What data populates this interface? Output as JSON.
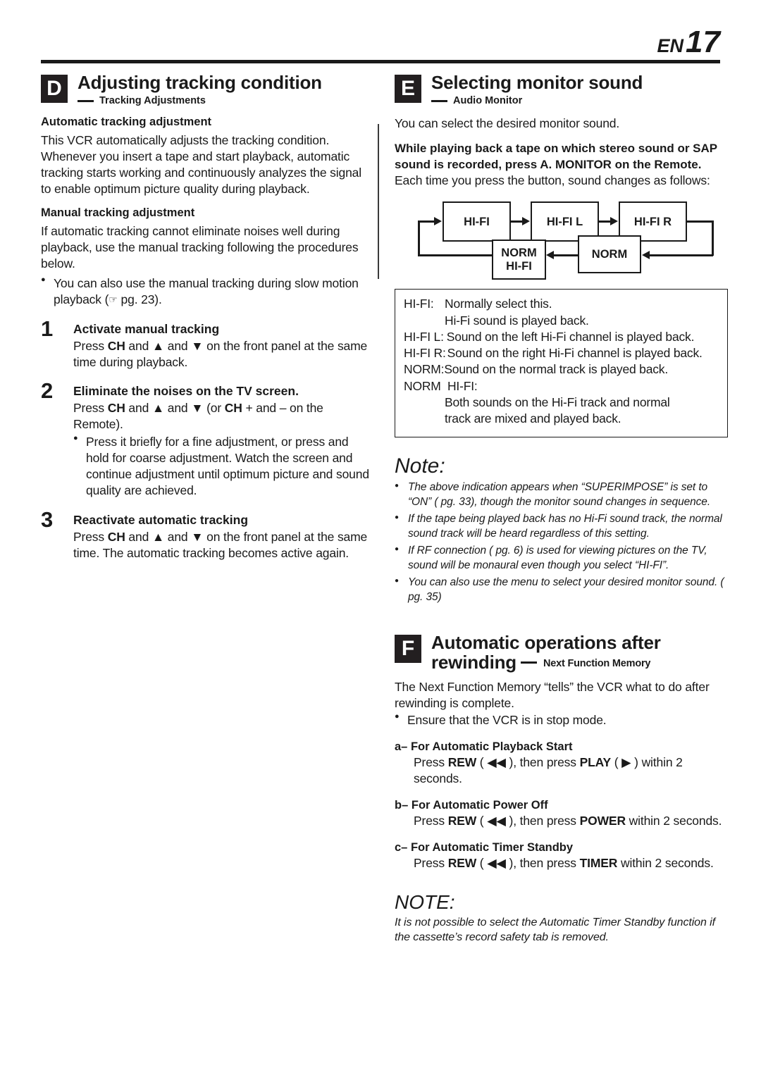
{
  "page": {
    "prefix": "EN",
    "number": "17"
  },
  "icons": {
    "hand_pointer": "☞",
    "triangle_up": "▲",
    "triangle_down": "▼",
    "rewind": "◀◀",
    "play": "▶",
    "bullet": "●"
  },
  "colors": {
    "ink": "#1a1a1a",
    "badge_bg": "#231f20",
    "badge_fg": "#ffffff",
    "page_bg": "#ffffff"
  },
  "section_d": {
    "badge": "D",
    "title": "Adjusting tracking condition",
    "subtitle": "Tracking Adjustments",
    "auto_heading": "Automatic tracking adjustment",
    "auto_body": "This VCR automatically adjusts the tracking condition. Whenever you insert a tape and start playback, automatic tracking starts working and continuously analyzes the signal to enable optimum picture quality during playback.",
    "manual_heading": "Manual tracking adjustment",
    "manual_body": "If automatic tracking cannot eliminate noises well during playback, use the manual tracking following the procedures below.",
    "manual_bullet_pre": "You can also use the manual tracking during slow motion playback (",
    "manual_bullet_ref": " pg. 23).",
    "steps": [
      {
        "number": "1",
        "title": "Activate manual tracking",
        "body_1": "Press ",
        "body_bold_1": "CH",
        "body_2": " and ",
        "body_3": " on the front panel at the same time during playback."
      },
      {
        "number": "2",
        "title": "Eliminate the noises on the TV screen.",
        "body_1": "Press ",
        "body_bold_1": "CH",
        "body_2": " and ",
        "body_3": " (or ",
        "body_bold_2": "CH",
        "body_4": " + and – on the Remote).",
        "bullet": "Press it briefly for a fine adjustment, or press and hold for coarse adjustment. Watch the screen and continue adjustment until optimum picture and sound quality are achieved."
      },
      {
        "number": "3",
        "title": "Reactivate automatic tracking",
        "body_1": "Press ",
        "body_bold_1": "CH",
        "body_2": " and ",
        "body_3": " on the front panel at the same time. The automatic tracking becomes active again."
      }
    ]
  },
  "section_e": {
    "badge": "E",
    "title": "Selecting monitor sound",
    "subtitle": "Audio Monitor",
    "intro": "You can select the desired monitor sound.",
    "instruction_bold": "While playing back a tape on which stereo sound or SAP sound is recorded, press A. MONITOR on the Remote.",
    "instruction_plain": "Each time you press the button, sound changes as follows:",
    "flow": {
      "type": "cycle",
      "nodes": [
        {
          "id": "hifi",
          "label": "HI-FI"
        },
        {
          "id": "hifi_l",
          "label": "HI-FI L"
        },
        {
          "id": "hifi_r",
          "label": "HI-FI R"
        },
        {
          "id": "norm",
          "label": "NORM"
        },
        {
          "id": "norm_hifi",
          "label_line1": "NORM",
          "label_line2": "HI-FI"
        }
      ],
      "order": [
        "HI-FI",
        "HI-FI L",
        "HI-FI R",
        "NORM",
        "NORM HI-FI",
        "HI-FI"
      ]
    },
    "explanations": [
      {
        "label": "HI-FI:",
        "lines": [
          "Normally select this.",
          "Hi-Fi sound is played back."
        ]
      },
      {
        "label": "HI-FI L:",
        "lines": [
          "Sound on the left Hi-Fi channel is played back."
        ]
      },
      {
        "label": "HI-FI R:",
        "lines": [
          "Sound on the right Hi-Fi channel is played back."
        ]
      },
      {
        "label": "NORM:",
        "lines": [
          "Sound on the normal track is played back."
        ]
      },
      {
        "label": "NORM  HI-FI:",
        "lines": [
          "Both sounds on the Hi-Fi track and normal",
          "track are mixed and played back."
        ]
      }
    ],
    "note_title": "Note:",
    "notes": [
      "The above indication appears when “SUPERIMPOSE” is set to “ON” ( pg. 33), though the monitor sound changes in sequence.",
      "If the tape being played back has no Hi-Fi sound track, the normal sound track will be heard regardless of this setting.",
      "If RF connection ( pg. 6) is used for viewing pictures on the TV, sound will be monaural even though you select “HI-FI”.",
      "You can also use the menu to select your desired monitor sound. ( pg. 35)"
    ]
  },
  "section_f": {
    "badge": "F",
    "title_line1": "Automatic operations after",
    "title_line2": "rewinding",
    "subtitle": "Next Function Memory",
    "body": "The Next Function Memory “tells” the VCR what to do after rewinding is complete.",
    "bullet": "Ensure that the VCR is in stop mode.",
    "items": [
      {
        "marker": "a–",
        "title": "For Automatic Playback Start",
        "body_1": "Press ",
        "body_bold_1": "REW",
        "body_2": " ( ",
        "body_icon_1": "◀◀",
        "body_3": " ), then press ",
        "body_bold_2": "PLAY",
        "body_4": " ( ",
        "body_icon_2": "▶",
        "body_5": " ) within 2 seconds."
      },
      {
        "marker": "b–",
        "title": "For Automatic Power Off",
        "body_1": "Press ",
        "body_bold_1": "REW",
        "body_2": " ( ",
        "body_icon_1": "◀◀",
        "body_3": " ), then press ",
        "body_bold_2": "POWER",
        "body_4": " within 2 seconds."
      },
      {
        "marker": "c–",
        "title": "For Automatic Timer Standby",
        "body_1": "Press ",
        "body_bold_1": "REW",
        "body_2": " ( ",
        "body_icon_1": "◀◀",
        "body_3": " ), then press ",
        "body_bold_2": "TIMER",
        "body_4": " within 2 seconds."
      }
    ],
    "note_title": "NOTE:",
    "note_body": "It is not possible to select the Automatic Timer Standby function if the cassette’s record safety tab is removed."
  }
}
